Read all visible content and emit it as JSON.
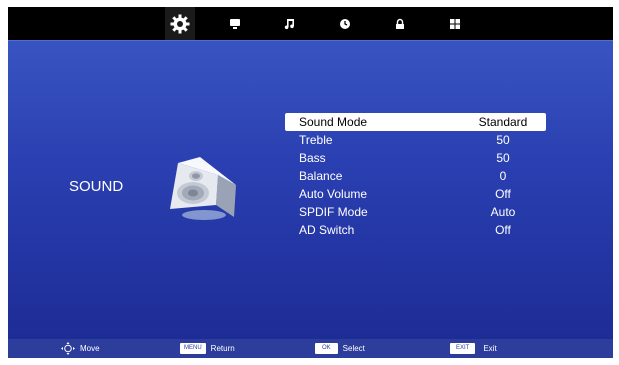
{
  "top_tabs": [
    {
      "icon": "gear-icon",
      "selected": true
    },
    {
      "icon": "monitor-icon",
      "selected": false
    },
    {
      "icon": "music-note-icon",
      "selected": false
    },
    {
      "icon": "clock-icon",
      "selected": false
    },
    {
      "icon": "lock-icon",
      "selected": false
    },
    {
      "icon": "grid-icon",
      "selected": false
    }
  ],
  "section": {
    "title": "SOUND",
    "icon": "speaker-icon"
  },
  "menu": {
    "items": [
      {
        "label": "Sound Mode",
        "value": "Standard",
        "selected": true
      },
      {
        "label": "Treble",
        "value": "50"
      },
      {
        "label": "Bass",
        "value": "50"
      },
      {
        "label": "Balance",
        "value": "0"
      },
      {
        "label": "Auto Volume",
        "value": "Off"
      },
      {
        "label": "SPDIF Mode",
        "value": "Auto"
      },
      {
        "label": "AD Switch",
        "value": "Off"
      }
    ]
  },
  "footer": {
    "move_label": "Move",
    "menu_key": "MENU",
    "return_label": "Return",
    "ok_key": "OK",
    "select_label": "Select",
    "exit_key": "EXIT",
    "exit_label": "Exit"
  },
  "colors": {
    "top_bar": "#000000",
    "background_top": "#3d5ac6",
    "background_bottom": "#1c2a93",
    "footer": "#2d3d9b",
    "selection": "#ffffff"
  }
}
